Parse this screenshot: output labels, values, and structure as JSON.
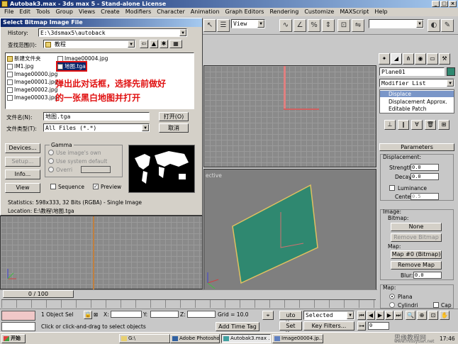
{
  "window": {
    "title": "Autobak3.max - 3ds max 5 - Stand-alone License",
    "min": "_",
    "max": "□",
    "close": "×"
  },
  "menu": [
    "File",
    "Edit",
    "Tools",
    "Group",
    "Views",
    "Create",
    "Modifiers",
    "Character",
    "Animation",
    "Graph Editors",
    "Rendering",
    "Customize",
    "MAXScript",
    "Help"
  ],
  "toolbar": {
    "view_select": "View",
    "selection_set": ""
  },
  "dialog": {
    "title": "Select Bitmap Image File",
    "history_label": "History:",
    "history_value": "E:\\3dsmax5\\autoback",
    "lookin_label": "查找范围(I):",
    "lookin_value": "教程",
    "files_col1": [
      "新建文件夹",
      "IM1.jpg",
      "Image00000.jpg",
      "Image00001.jpg",
      "Image00002.jpg",
      "Image00003.jpg"
    ],
    "files_col2": [
      "Image00004.jpg",
      "地图.tga"
    ],
    "annotation_line1": "弹出此对话框，选择先前做好",
    "annotation_line2": "的一张黑白地图并打开",
    "filename_label": "文件名(N):",
    "filename_value": "地图.tga",
    "filetype_label": "文件类型(T):",
    "filetype_value": "All Files (*.*)",
    "open_button": "打开(O)",
    "cancel_button": "取消",
    "devices_button": "Devices...",
    "setup_button": "Setup...",
    "info_button": "Info...",
    "view_button": "View",
    "gamma_label": "Gamma",
    "gamma_opt1": "Use image's own",
    "gamma_opt2": "Use system default",
    "gamma_opt3": "Overri",
    "sequence_label": "Sequence",
    "preview_label": "Preview",
    "statistics": "Statistics:  598x333, 32 Bits (RGBA) - Single Image",
    "location": "Location:  E:\\教程\\地图.tga"
  },
  "viewports": {
    "perspective_label": "ective",
    "frame_counter": "0 / 100"
  },
  "command_panel": {
    "object_name": "Plane01",
    "modifier_list": "Modifier List",
    "stack": [
      "Displace",
      "Displacement Approx.",
      "Editable Patch"
    ],
    "parameters_title": "Parameters",
    "displacement_title": "Displacement:",
    "strength_label": "Strength:",
    "strength_value": "0.0",
    "decay_label": "Decay:",
    "decay_value": "0.0",
    "luminance_label": "Luminance",
    "center_label": "Center:",
    "center_value": "0.5",
    "image_title": "Image:",
    "bitmap_label": "Bitmap:",
    "bitmap_button": "None",
    "remove_bitmap_button": "Remove Bitmap",
    "map_label": "Map:",
    "map_button": "Map #0 (Bitmap)",
    "remove_map_button": "Remove Map",
    "blur_label": "Blur:",
    "blur_value": "0.0",
    "map_title": "Map:",
    "planar_label": "Plana",
    "cylindrical_label": "Cylindri",
    "cap_label": "Cap"
  },
  "status": {
    "selection_count": "1 Object Sel",
    "x_label": "X:",
    "y_label": "Y:",
    "z_label": "Z:",
    "grid": "Grid = 10.0",
    "prompt": "Click or click-and-drag to select objects",
    "add_time_tag": "Add Time Tag",
    "auto_key": "uto Key",
    "selected_value": "Selected",
    "set_key": "Set Key",
    "key_filters": "Key Filters...",
    "frame_value": "0"
  },
  "taskbar": {
    "start": "开始",
    "tasks": [
      "G:\\",
      "Adobe Photoshop",
      "Autobak3.max ...",
      "Image00004.jp..."
    ],
    "watermark": "思缘教程网",
    "watermark_url": "www.missyuan.net",
    "clock": "17:46"
  }
}
